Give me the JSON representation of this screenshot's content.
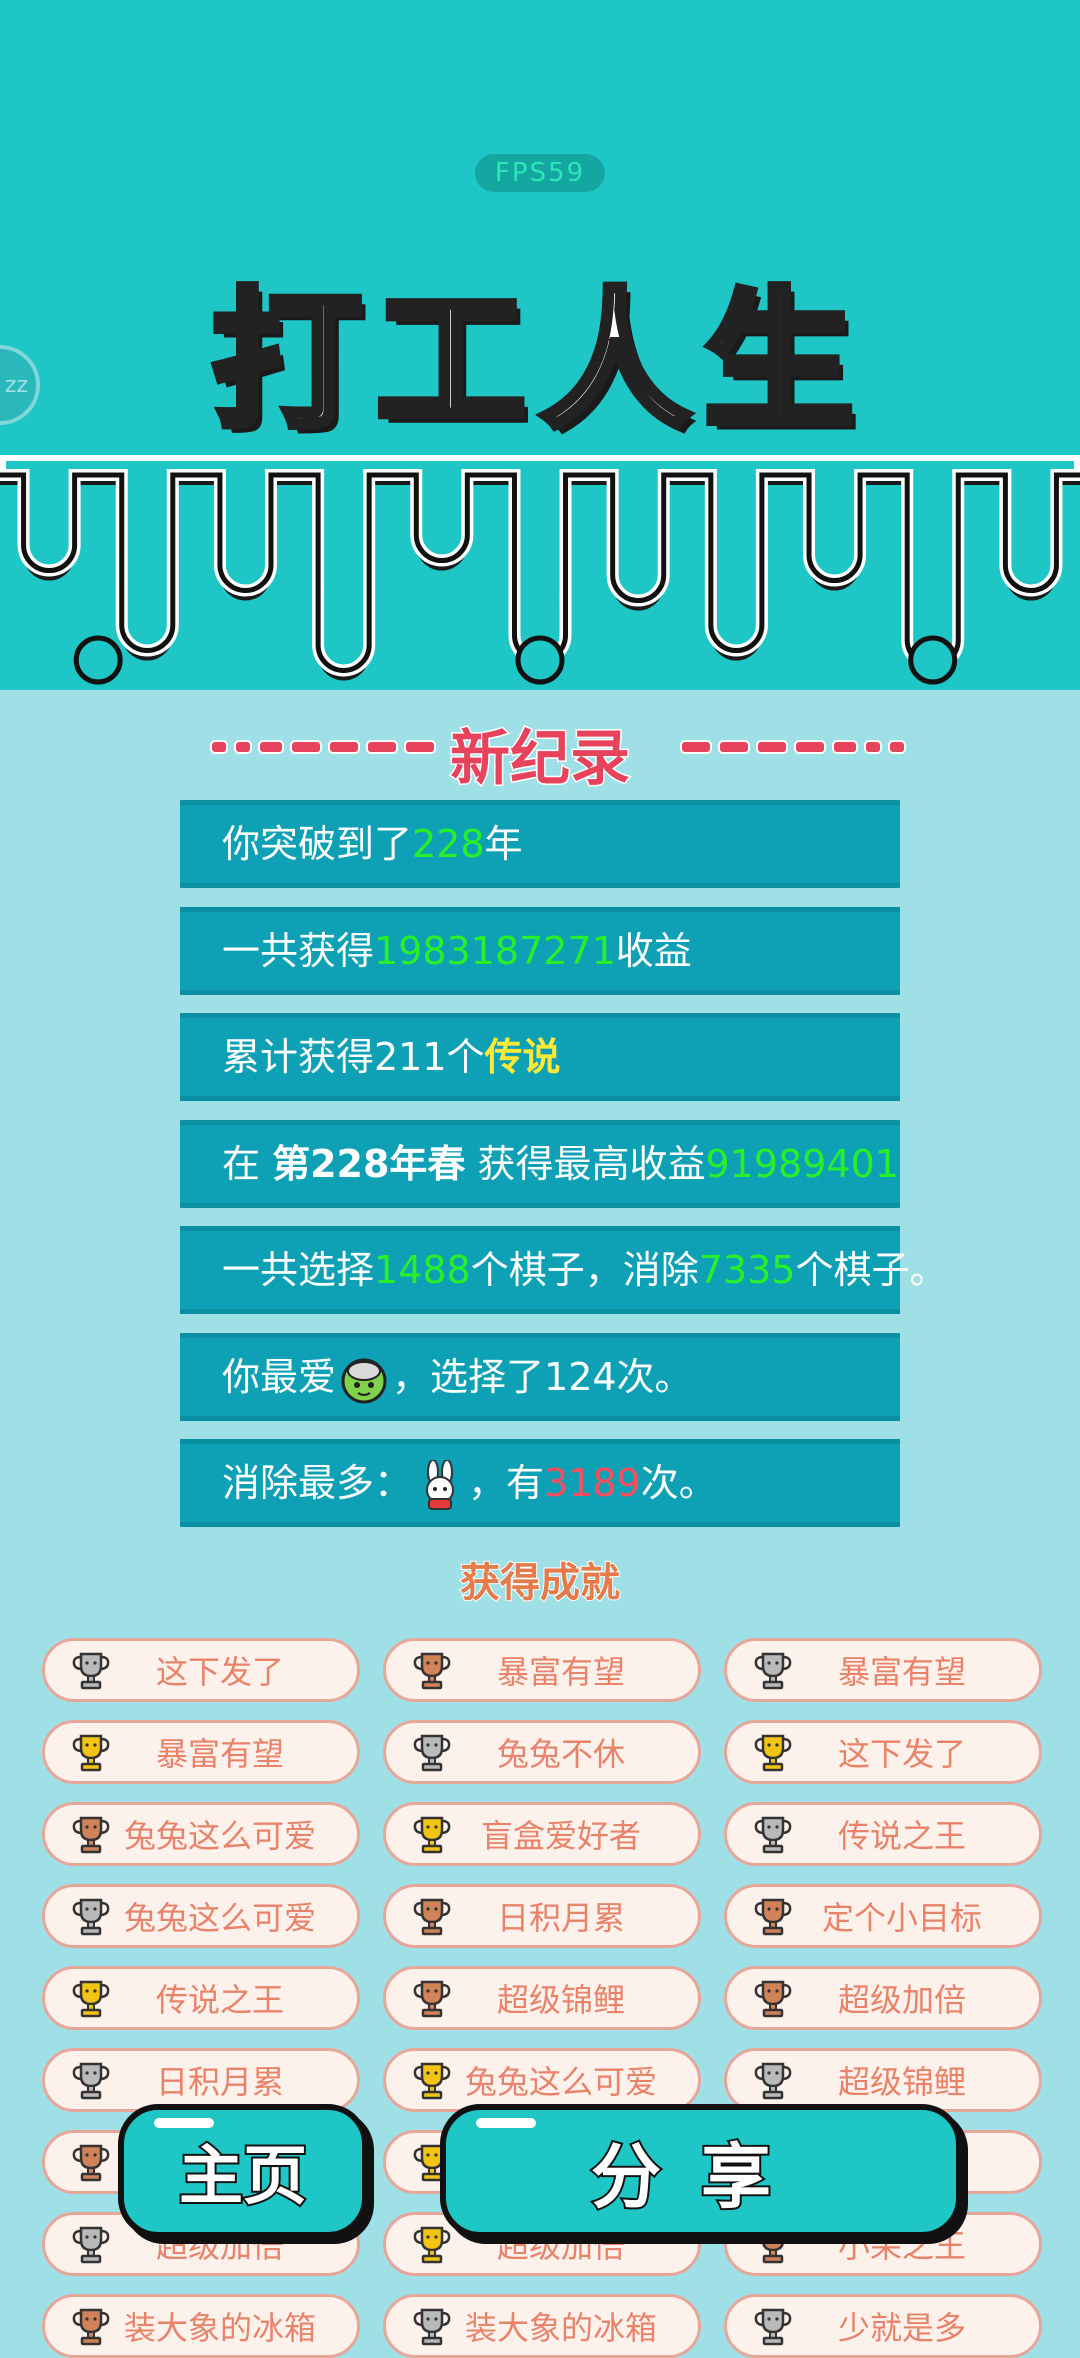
{
  "fps": "FPS59",
  "side_button": "zz",
  "title": "打工人生",
  "record_title": "新纪录",
  "stats": [
    {
      "parts": [
        {
          "t": "你突破到了"
        },
        {
          "t": "228",
          "c": "g"
        },
        {
          "t": "年"
        }
      ]
    },
    {
      "parts": [
        {
          "t": "一共获得"
        },
        {
          "t": "1983187271",
          "c": "g"
        },
        {
          "t": "收益"
        }
      ]
    },
    {
      "parts": [
        {
          "t": "累计获得211个"
        },
        {
          "t": "传说",
          "c": "y"
        }
      ]
    },
    {
      "parts": [
        {
          "t": "在 "
        },
        {
          "t": "第228年春",
          "c": "b"
        },
        {
          "t": " 获得最高收益"
        },
        {
          "t": "91989401",
          "c": "g"
        }
      ]
    },
    {
      "parts": [
        {
          "t": "一共选择"
        },
        {
          "t": "1488",
          "c": "g"
        },
        {
          "t": "个棋子，消除"
        },
        {
          "t": "7335",
          "c": "g"
        },
        {
          "t": "个棋子。"
        }
      ]
    },
    {
      "parts": [
        {
          "t": "你最爱"
        },
        {
          "icon": "green-blob-icon"
        },
        {
          "t": "，选择了124次。"
        }
      ]
    },
    {
      "parts": [
        {
          "t": "消除最多："
        },
        {
          "icon": "rabbit-icon"
        },
        {
          "t": "，有"
        },
        {
          "t": "3189",
          "c": "r"
        },
        {
          "t": "次。"
        }
      ]
    }
  ],
  "achievements_title": "获得成就",
  "achievements": [
    {
      "label": "这下发了",
      "trophy": "silver"
    },
    {
      "label": "暴富有望",
      "trophy": "bronze"
    },
    {
      "label": "暴富有望",
      "trophy": "silver"
    },
    {
      "label": "暴富有望",
      "trophy": "gold"
    },
    {
      "label": "兔兔不休",
      "trophy": "silver"
    },
    {
      "label": "这下发了",
      "trophy": "gold"
    },
    {
      "label": "兔兔这么可爱",
      "trophy": "bronze"
    },
    {
      "label": "盲盒爱好者",
      "trophy": "gold"
    },
    {
      "label": "传说之王",
      "trophy": "silver"
    },
    {
      "label": "兔兔这么可爱",
      "trophy": "silver"
    },
    {
      "label": "日积月累",
      "trophy": "bronze"
    },
    {
      "label": "定个小目标",
      "trophy": "bronze"
    },
    {
      "label": "传说之王",
      "trophy": "gold"
    },
    {
      "label": "超级锦鲤",
      "trophy": "bronze"
    },
    {
      "label": "超级加倍",
      "trophy": "bronze"
    },
    {
      "label": "日积月累",
      "trophy": "silver"
    },
    {
      "label": "兔兔这么可爱",
      "trophy": "gold"
    },
    {
      "label": "超级锦鲤",
      "trophy": "silver"
    },
    {
      "label": "",
      "trophy": "bronze"
    },
    {
      "label": "",
      "trophy": "gold"
    },
    {
      "label": "翁",
      "trophy": "bronze"
    },
    {
      "label": "超级加倍",
      "trophy": "silver"
    },
    {
      "label": "超级加倍",
      "trophy": "gold"
    },
    {
      "label": "小呆之王",
      "trophy": "bronze"
    },
    {
      "label": "装大象的冰箱",
      "trophy": "bronze"
    },
    {
      "label": "装大象的冰箱",
      "trophy": "silver"
    },
    {
      "label": "少就是多",
      "trophy": "silver"
    }
  ],
  "trophy_colors": {
    "gold": "#f2c413",
    "silver": "#b9b9b9",
    "bronze": "#d08258"
  },
  "buttons": {
    "home": "主页",
    "share": "分享"
  }
}
